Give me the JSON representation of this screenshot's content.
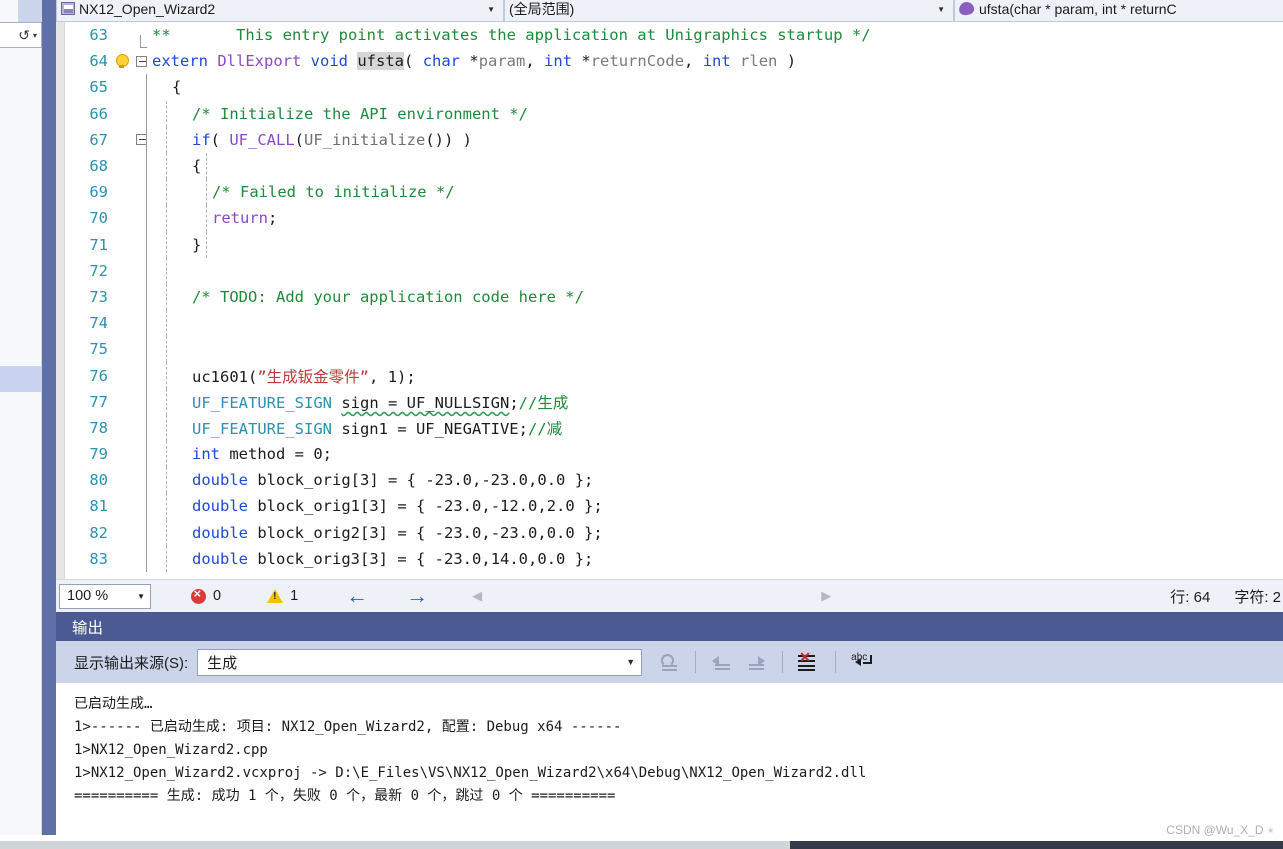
{
  "navbar": {
    "project_combo": {
      "label": "NX12_Open_Wizard2",
      "icon": "project-icon",
      "caret": "▼"
    },
    "scope_combo": {
      "label": "(全局范围)",
      "caret": "▼"
    },
    "member_combo": {
      "label": "ufsta(char * param, int * returnC",
      "icon": "method-icon"
    }
  },
  "editor": {
    "lines": [
      {
        "num": "63",
        "bulb": false,
        "fold": "endbracket",
        "indent": 0,
        "tokens": [
          {
            "t": "**       This entry point activates the application at Unigraphics startup */",
            "c": "t-cmt"
          }
        ]
      },
      {
        "num": "64",
        "bulb": true,
        "fold": "minus",
        "indent": 0,
        "tokens": [
          {
            "t": "extern ",
            "c": "t-kw"
          },
          {
            "t": "DllExport",
            "c": "t-macro"
          },
          {
            "t": " ",
            "c": "t-plain"
          },
          {
            "t": "void",
            "c": "t-kw"
          },
          {
            "t": " ",
            "c": "t-plain"
          },
          {
            "t": "ufsta",
            "c": "t-plain t-hl"
          },
          {
            "t": "( ",
            "c": "t-plain"
          },
          {
            "t": "char",
            "c": "t-kw"
          },
          {
            "t": " *",
            "c": "t-plain"
          },
          {
            "t": "param",
            "c": "t-var"
          },
          {
            "t": ", ",
            "c": "t-plain"
          },
          {
            "t": "int",
            "c": "t-kw"
          },
          {
            "t": " *",
            "c": "t-plain"
          },
          {
            "t": "returnCode",
            "c": "t-var"
          },
          {
            "t": ", ",
            "c": "t-plain"
          },
          {
            "t": "int",
            "c": "t-kw"
          },
          {
            "t": " ",
            "c": "t-plain"
          },
          {
            "t": "rlen",
            "c": "t-var"
          },
          {
            "t": " )",
            "c": "t-plain"
          }
        ]
      },
      {
        "num": "65",
        "bulb": false,
        "fold": "none",
        "indent": 1,
        "tokens": [
          {
            "t": "{",
            "c": "t-plain"
          }
        ]
      },
      {
        "num": "66",
        "bulb": false,
        "fold": "none",
        "indent": 2,
        "tokens": [
          {
            "t": "/* Initialize the API environment */",
            "c": "t-cmt"
          }
        ]
      },
      {
        "num": "67",
        "bulb": false,
        "fold": "minus-inner",
        "indent": 2,
        "tokens": [
          {
            "t": "if",
            "c": "t-kw"
          },
          {
            "t": "( ",
            "c": "t-plain"
          },
          {
            "t": "UF_CALL",
            "c": "t-macro"
          },
          {
            "t": "(",
            "c": "t-plain"
          },
          {
            "t": "UF_initialize",
            "c": "t-fn"
          },
          {
            "t": "()) )",
            "c": "t-plain"
          }
        ]
      },
      {
        "num": "68",
        "bulb": false,
        "fold": "none",
        "indent": 2,
        "tokens": [
          {
            "t": "{",
            "c": "t-plain"
          }
        ]
      },
      {
        "num": "69",
        "bulb": false,
        "fold": "none",
        "indent": 3,
        "tokens": [
          {
            "t": "/* Failed to initialize */",
            "c": "t-cmt"
          }
        ]
      },
      {
        "num": "70",
        "bulb": false,
        "fold": "none",
        "indent": 3,
        "tokens": [
          {
            "t": "return",
            "c": "t-purple"
          },
          {
            "t": ";",
            "c": "t-plain"
          }
        ]
      },
      {
        "num": "71",
        "bulb": false,
        "fold": "none",
        "indent": 2,
        "tokens": [
          {
            "t": "}",
            "c": "t-plain"
          }
        ]
      },
      {
        "num": "72",
        "bulb": false,
        "fold": "none",
        "indent": 0,
        "tokens": []
      },
      {
        "num": "73",
        "bulb": false,
        "fold": "none",
        "indent": 2,
        "tokens": [
          {
            "t": "/* TODO: Add your application code here */",
            "c": "t-cmt"
          }
        ]
      },
      {
        "num": "74",
        "bulb": false,
        "fold": "none",
        "indent": 0,
        "tokens": []
      },
      {
        "num": "75",
        "bulb": false,
        "fold": "none",
        "indent": 0,
        "tokens": []
      },
      {
        "num": "76",
        "bulb": false,
        "fold": "none",
        "indent": 2,
        "tokens": [
          {
            "t": "uc1601",
            "c": "t-plain"
          },
          {
            "t": "(",
            "c": "t-plain"
          },
          {
            "t": "”生成钣金零件”",
            "c": "t-str"
          },
          {
            "t": ", ",
            "c": "t-plain"
          },
          {
            "t": "1",
            "c": "t-num"
          },
          {
            "t": ");",
            "c": "t-plain"
          }
        ]
      },
      {
        "num": "77",
        "bulb": false,
        "fold": "none",
        "indent": 2,
        "tokens": [
          {
            "t": "UF_FEATURE_SIGN",
            "c": "t-type"
          },
          {
            "t": " ",
            "c": "t-plain"
          },
          {
            "t": "sign = UF_NULLSIGN",
            "c": "t-plain t-squig"
          },
          {
            "t": ";",
            "c": "t-plain"
          },
          {
            "t": "//生成",
            "c": "t-cmt"
          }
        ]
      },
      {
        "num": "78",
        "bulb": false,
        "fold": "none",
        "indent": 2,
        "tokens": [
          {
            "t": "UF_FEATURE_SIGN",
            "c": "t-type"
          },
          {
            "t": " sign1 = UF_NEGATIVE;",
            "c": "t-plain"
          },
          {
            "t": "//减",
            "c": "t-cmt"
          }
        ]
      },
      {
        "num": "79",
        "bulb": false,
        "fold": "none",
        "indent": 2,
        "tokens": [
          {
            "t": "int",
            "c": "t-kw"
          },
          {
            "t": " method = ",
            "c": "t-plain"
          },
          {
            "t": "0",
            "c": "t-num"
          },
          {
            "t": ";",
            "c": "t-plain"
          }
        ]
      },
      {
        "num": "80",
        "bulb": false,
        "fold": "none",
        "indent": 2,
        "tokens": [
          {
            "t": "double",
            "c": "t-kw"
          },
          {
            "t": " block_orig[",
            "c": "t-plain"
          },
          {
            "t": "3",
            "c": "t-num"
          },
          {
            "t": "] = { ",
            "c": "t-plain"
          },
          {
            "t": "-23.0",
            "c": "t-num"
          },
          {
            "t": ",",
            "c": "t-plain"
          },
          {
            "t": "-23.0",
            "c": "t-num"
          },
          {
            "t": ",",
            "c": "t-plain"
          },
          {
            "t": "0.0",
            "c": "t-num"
          },
          {
            "t": " };",
            "c": "t-plain"
          }
        ]
      },
      {
        "num": "81",
        "bulb": false,
        "fold": "none",
        "indent": 2,
        "tokens": [
          {
            "t": "double",
            "c": "t-kw"
          },
          {
            "t": " block_orig1[",
            "c": "t-plain"
          },
          {
            "t": "3",
            "c": "t-num"
          },
          {
            "t": "] = { ",
            "c": "t-plain"
          },
          {
            "t": "-23.0",
            "c": "t-num"
          },
          {
            "t": ",",
            "c": "t-plain"
          },
          {
            "t": "-12.0",
            "c": "t-num"
          },
          {
            "t": ",",
            "c": "t-plain"
          },
          {
            "t": "2.0",
            "c": "t-num"
          },
          {
            "t": " };",
            "c": "t-plain"
          }
        ]
      },
      {
        "num": "82",
        "bulb": false,
        "fold": "none",
        "indent": 2,
        "tokens": [
          {
            "t": "double",
            "c": "t-kw"
          },
          {
            "t": " block_orig2[",
            "c": "t-plain"
          },
          {
            "t": "3",
            "c": "t-num"
          },
          {
            "t": "] = { ",
            "c": "t-plain"
          },
          {
            "t": "-23.0",
            "c": "t-num"
          },
          {
            "t": ",",
            "c": "t-plain"
          },
          {
            "t": "-23.0",
            "c": "t-num"
          },
          {
            "t": ",",
            "c": "t-plain"
          },
          {
            "t": "0.0",
            "c": "t-num"
          },
          {
            "t": " };",
            "c": "t-plain"
          }
        ]
      },
      {
        "num": "83",
        "bulb": false,
        "fold": "none",
        "indent": 2,
        "tokens": [
          {
            "t": "double",
            "c": "t-kw"
          },
          {
            "t": " block_orig3[",
            "c": "t-plain"
          },
          {
            "t": "3",
            "c": "t-num"
          },
          {
            "t": "] = { ",
            "c": "t-plain"
          },
          {
            "t": "-23.0",
            "c": "t-num"
          },
          {
            "t": ",",
            "c": "t-plain"
          },
          {
            "t": "14.0",
            "c": "t-num"
          },
          {
            "t": ",",
            "c": "t-plain"
          },
          {
            "t": "0.0",
            "c": "t-num"
          },
          {
            "t": " };",
            "c": "t-plain"
          }
        ]
      }
    ]
  },
  "status": {
    "zoom_level": "100 %",
    "zoom_caret": "▼",
    "error_count": "0",
    "warning_count": "1",
    "prev_arrow": "←",
    "next_arrow": "→",
    "scroll_left": "◀",
    "scroll_right": "▶",
    "line_label": "行: 64",
    "col_label": "字符: 2"
  },
  "output": {
    "title": "输出",
    "source_label": "显示输出来源(S):",
    "source_value": "生成",
    "source_caret": "▼",
    "toolbar_buttons": [
      {
        "name": "find-message-icon",
        "enabled": false
      },
      {
        "name": "go-to-previous-message-icon",
        "enabled": false
      },
      {
        "name": "go-to-next-message-icon",
        "enabled": false
      },
      {
        "name": "clear-all-icon",
        "enabled": true
      },
      {
        "name": "toggle-word-wrap-icon",
        "enabled": true
      }
    ],
    "log": "已启动生成…\n1>------ 已启动生成: 项目: NX12_Open_Wizard2, 配置: Debug x64 ------\n1>NX12_Open_Wizard2.cpp\n1>NX12_Open_Wizard2.vcxproj -> D:\\E_Files\\VS\\NX12_Open_Wizard2\\x64\\Debug\\NX12_Open_Wizard2.dll\n========== 生成: 成功 1 个，失败 0 个，最新 0 个，跳过 0 个 =========="
  },
  "left_panel": {
    "combo_glyph": "↺",
    "combo_caret": "▾"
  },
  "watermark": {
    "text": "CSDN @Wu_X_D",
    "star": "✴"
  },
  "colors": {
    "accent_blue": "#4b5a93",
    "divider_blue": "#5f6fa8",
    "toolbar_blue": "#ccd4ea",
    "comment_green": "#1f8a3b",
    "keyword_blue": "#1f49d8",
    "type_teal": "#2b91af",
    "macro_purple": "#8b4ac4",
    "string_red": "#bf3a3a",
    "error_red": "#d93a3a",
    "warning_yellow": "#f2c200"
  }
}
